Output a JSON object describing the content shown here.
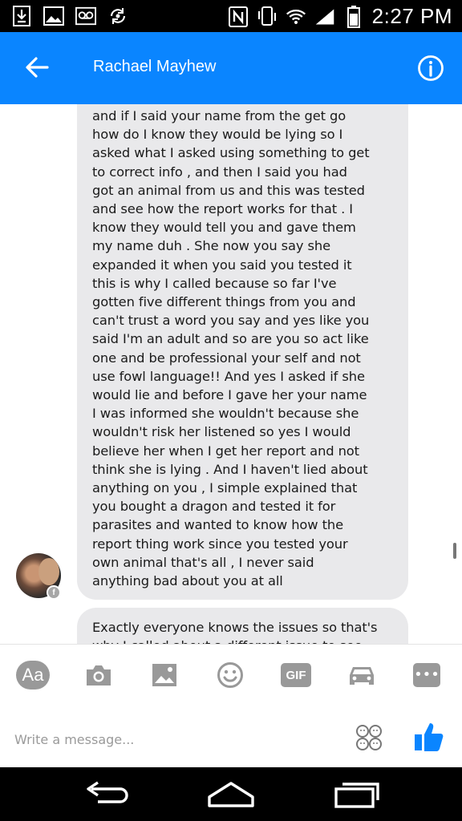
{
  "status_bar": {
    "time": "2:27 PM",
    "left_icons": [
      "download-icon",
      "image-icon",
      "voicemail-icon",
      "sync-icon"
    ],
    "right_icons": [
      "nfc-icon",
      "vibrate-icon",
      "wifi-icon",
      "signal-icon",
      "battery-icon"
    ]
  },
  "header": {
    "contact_name": "Rachael Mayhew",
    "back_icon": "back-arrow-icon",
    "info_icon": "info-icon"
  },
  "conversation": {
    "messages": [
      {
        "sender": "contact",
        "text": "and if I said your name from the get go\nhow do I know they would be lying so I\nasked what I asked using something to get\nto correct info , and then I said you had\ngot an animal from us and this was tested\nand see how the report works for that . I\nknow they would tell you and gave them\nmy name duh . She now you say she\nexpanded it when you said you tested it\nthis is why I called because so far I've\ngotten five different things from you and\ncan't trust a word you say and yes like you\nsaid I'm an adult and so are you so act like\none and be professional your self and not\nuse fowl language!! And yes I asked if she\nwould lie and before I gave her your name\nI was informed she wouldn't because she\nwouldn't risk her listened so yes I would\nbelieve her when I get her report and not\nthink she is lying . And I haven't lied about\nanything on you , I simple explained that\nyou bought a dragon and tested it for\nparasites and wanted to know how the\nreport thing work since you tested your\nown animal that's all , I never said\nanything bad about you at all"
      },
      {
        "sender": "contact",
        "text": "Exactly everyone knows the issues so that's\nwhy I called about a different issue to see"
      }
    ],
    "avatar_badge": "f"
  },
  "composer": {
    "aa_label": "Aa",
    "gif_label": "GIF",
    "more_label": "•••",
    "placeholder": "Write a message...",
    "icons": [
      "camera-icon",
      "gallery-icon",
      "emoji-icon",
      "car-icon",
      "sticker-icon",
      "thumbs-up-icon"
    ],
    "accent_color": "#0a85ff"
  },
  "nav_bar": {
    "icons": [
      "nav-back-icon",
      "home-icon",
      "recents-icon"
    ]
  }
}
